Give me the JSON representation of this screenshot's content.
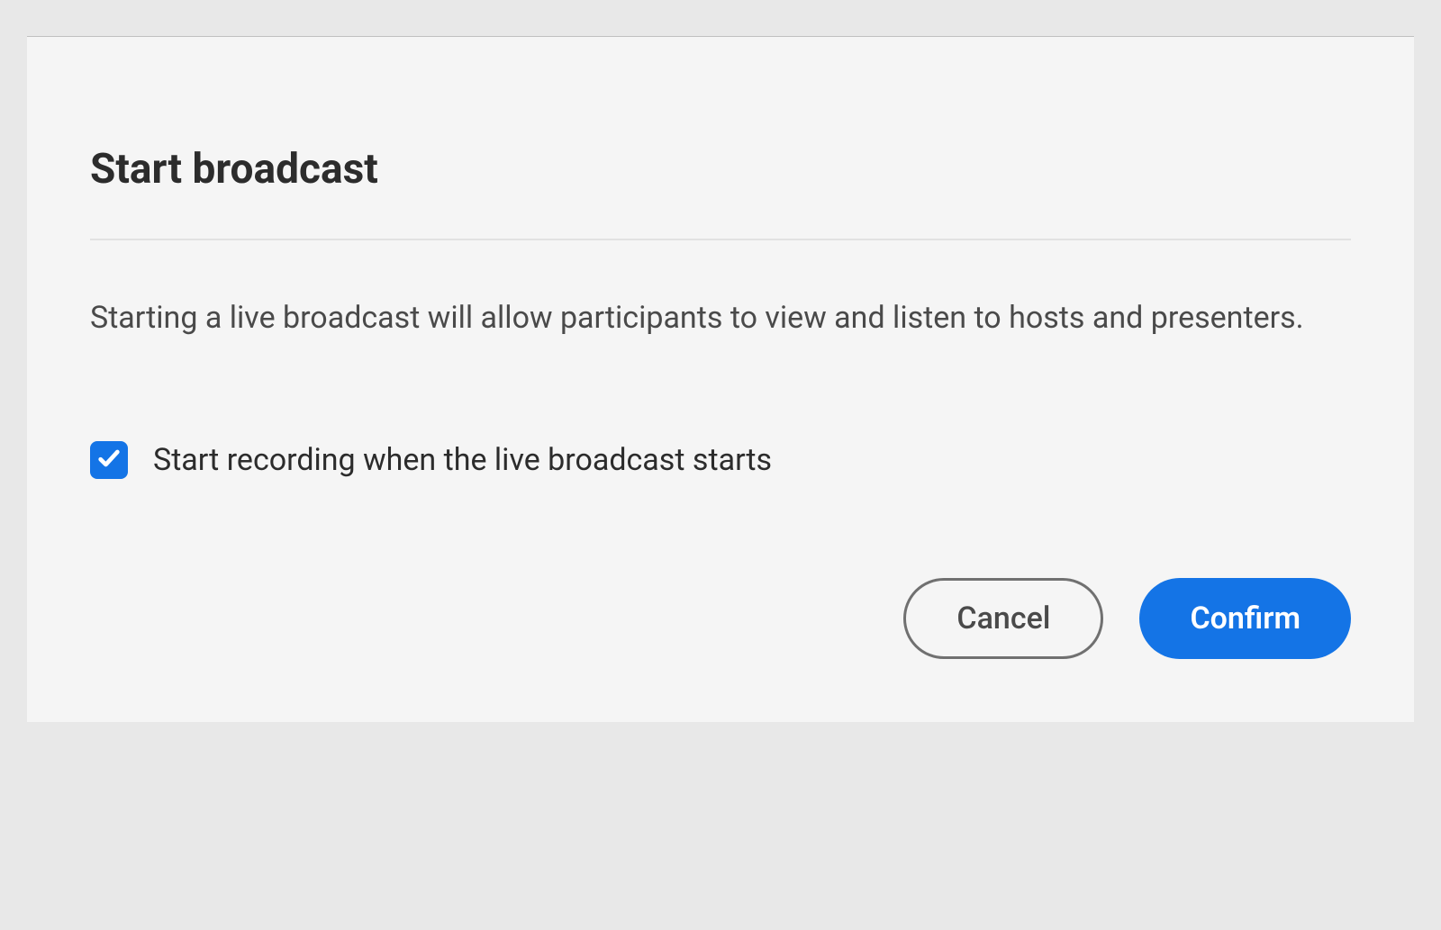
{
  "dialog": {
    "title": "Start broadcast",
    "description": "Starting a live broadcast will allow participants to view and listen to hosts and presenters.",
    "checkbox": {
      "label": "Start recording when the live broadcast starts",
      "checked": true
    },
    "buttons": {
      "cancel": "Cancel",
      "confirm": "Confirm"
    }
  }
}
